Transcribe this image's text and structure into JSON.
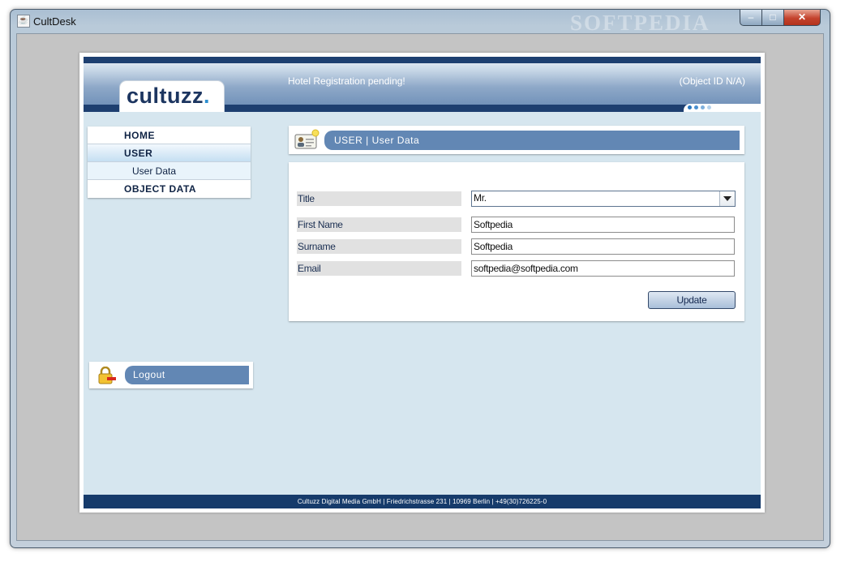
{
  "window": {
    "title": "CultDesk",
    "watermark": "SOFTPEDIA",
    "controls": {
      "minimize": "–",
      "maximize": "□",
      "close": "✕"
    }
  },
  "header": {
    "logo": {
      "text": "cultuzz",
      "dot": "."
    },
    "hotel_status": "Hotel Registration pending!",
    "object_id": "(Object ID  N/A)"
  },
  "nav": {
    "items": [
      {
        "label": "HOME"
      },
      {
        "label": "USER"
      },
      {
        "label": "User Data"
      },
      {
        "label": "OBJECT DATA"
      }
    ]
  },
  "logout": {
    "label": "Logout"
  },
  "section": {
    "title": "USER  |  User Data"
  },
  "form": {
    "title": {
      "label": "Title",
      "value": "Mr."
    },
    "first_name": {
      "label": "First Name",
      "value": "Softpedia"
    },
    "surname": {
      "label": "Surname",
      "value": "Softpedia"
    },
    "email": {
      "label": "Email",
      "value": "softpedia@softpedia.com"
    },
    "update_label": "Update"
  },
  "footer": {
    "text": "Cultuzz Digital Media GmbH | Friedrichstrasse 231 | 10969 Berlin | +49(30)726225-0"
  },
  "colors": {
    "brand_navy": "#1d3f70",
    "accent_blue": "#6287b4",
    "content_bg": "#d6e6ef"
  }
}
